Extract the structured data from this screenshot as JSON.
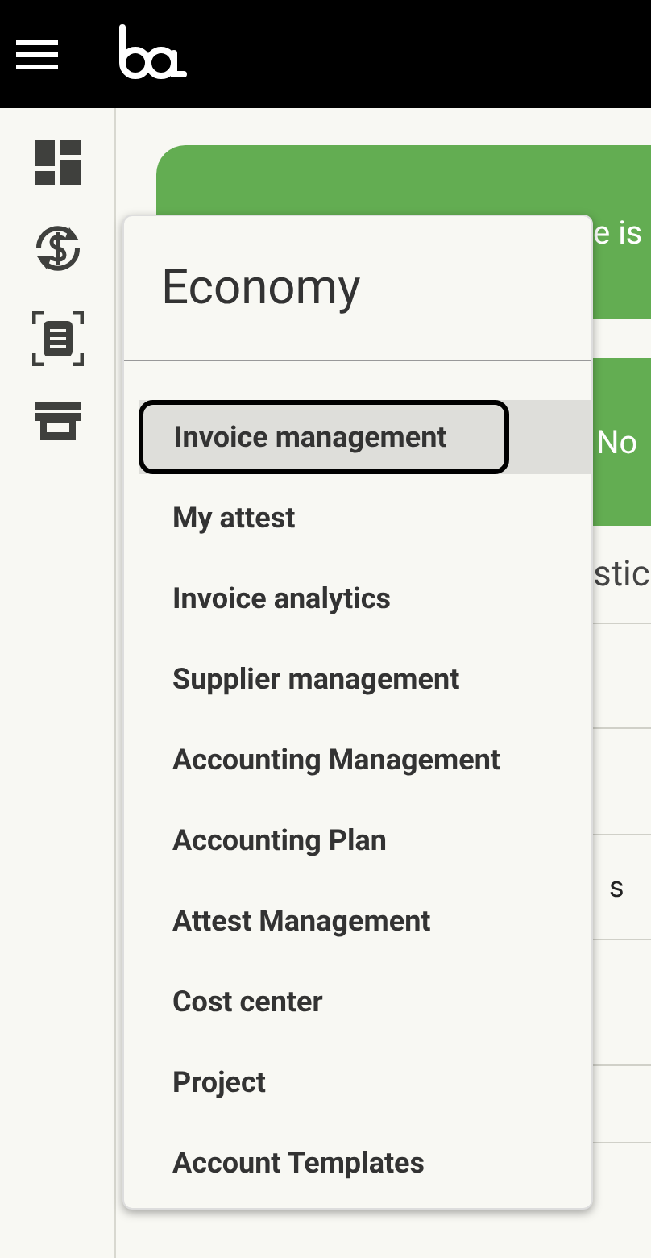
{
  "background": {
    "banner_text": "e is",
    "notice_text": "No",
    "section_title": "stic",
    "row_text": "s"
  },
  "menu": {
    "title": "Economy",
    "items": [
      {
        "label": "Invoice management",
        "selected": true
      },
      {
        "label": "My attest",
        "selected": false
      },
      {
        "label": "Invoice analytics",
        "selected": false
      },
      {
        "label": "Supplier management",
        "selected": false
      },
      {
        "label": "Accounting Management",
        "selected": false
      },
      {
        "label": "Accounting Plan",
        "selected": false
      },
      {
        "label": "Attest Management",
        "selected": false
      },
      {
        "label": "Cost center",
        "selected": false
      },
      {
        "label": "Project",
        "selected": false
      },
      {
        "label": "Account Templates",
        "selected": false
      }
    ]
  }
}
